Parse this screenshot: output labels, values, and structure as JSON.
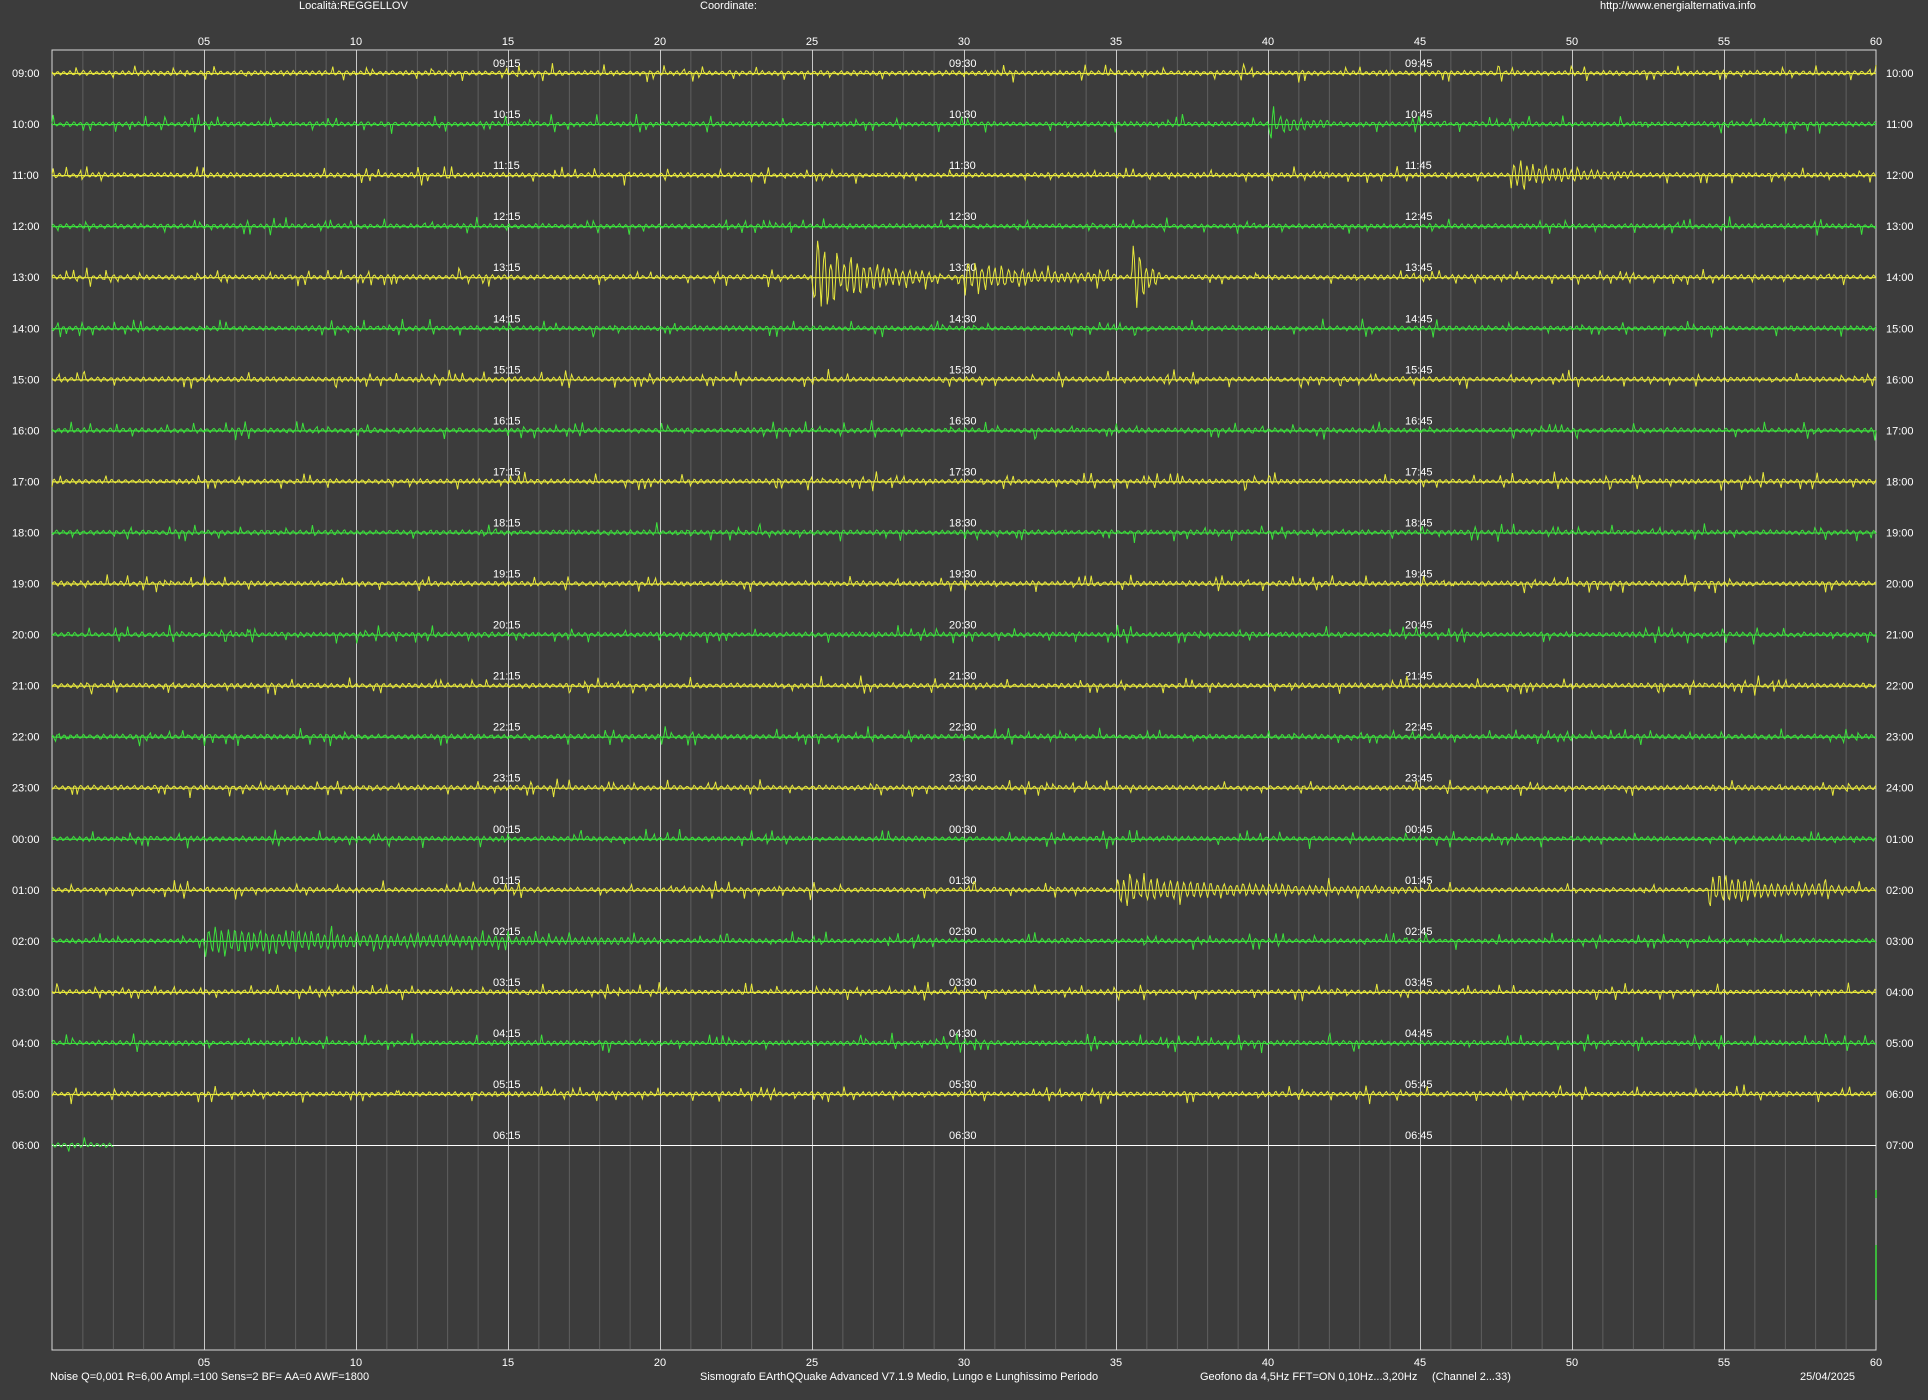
{
  "header": {
    "locality": "Località:REGGELLOV",
    "coordinates": "Coordinate:",
    "url": "http://www.energialternativa.info"
  },
  "footer": {
    "params": "Noise Q=0,001 R=6,00 Ampl.=100 Sens=2 BF= AA=0 AWF=1800",
    "software": "Sismografo  EArthQQuake Advanced V7.1.9  Medio, Lungo e Lunghissimo Periodo",
    "sensor": "Geofono da 4,5Hz FFT=ON 0,10Hz...3,20Hz",
    "channel": "(Channel 2...33)",
    "date": "25/04/2025"
  },
  "colors": {
    "background": "#3c3c3c",
    "trace_yellow": "#e8e83c",
    "trace_green": "#3ce03c",
    "grid_major": "#d8d8d8",
    "grid_minor": "#7a7a7a"
  },
  "chart_data": {
    "type": "line",
    "title": "",
    "xlabel": "",
    "ylabel": "",
    "x_unit": "minutes",
    "xlim": [
      0,
      60
    ],
    "x_ticks": [
      "05",
      "10",
      "15",
      "20",
      "25",
      "30",
      "35",
      "40",
      "45",
      "50",
      "55",
      "60"
    ],
    "left_labels": [
      "09:00",
      "10:00",
      "11:00",
      "12:00",
      "13:00",
      "14:00",
      "15:00",
      "16:00",
      "17:00",
      "18:00",
      "19:00",
      "20:00",
      "21:00",
      "22:00",
      "23:00",
      "00:00",
      "01:00",
      "02:00",
      "03:00",
      "04:00",
      "05:00",
      "06:00"
    ],
    "right_labels": [
      "10:00",
      "11:00",
      "12:00",
      "13:00",
      "14:00",
      "15:00",
      "16:00",
      "17:00",
      "18:00",
      "19:00",
      "20:00",
      "21:00",
      "22:00",
      "23:00",
      "24:00",
      "01:00",
      "02:00",
      "03:00",
      "04:00",
      "05:00",
      "06:00",
      "07:00"
    ],
    "quarter_labels": [
      [
        "09:15",
        "09:30",
        "09:45"
      ],
      [
        "10:15",
        "10:30",
        "10:45"
      ],
      [
        "11:15",
        "11:30",
        "11:45"
      ],
      [
        "12:15",
        "12:30",
        "12:45"
      ],
      [
        "13:15",
        "13:30",
        "13:45"
      ],
      [
        "14:15",
        "14:30",
        "14:45"
      ],
      [
        "15:15",
        "15:30",
        "15:45"
      ],
      [
        "16:15",
        "16:30",
        "16:45"
      ],
      [
        "17:15",
        "17:30",
        "17:45"
      ],
      [
        "18:15",
        "18:30",
        "18:45"
      ],
      [
        "19:15",
        "19:30",
        "19:45"
      ],
      [
        "20:15",
        "20:30",
        "20:45"
      ],
      [
        "21:15",
        "21:30",
        "21:45"
      ],
      [
        "22:15",
        "22:30",
        "22:45"
      ],
      [
        "23:15",
        "23:30",
        "23:45"
      ],
      [
        "00:15",
        "00:30",
        "00:45"
      ],
      [
        "01:15",
        "01:30",
        "01:45"
      ],
      [
        "02:15",
        "02:30",
        "02:45"
      ],
      [
        "03:15",
        "03:30",
        "03:45"
      ],
      [
        "04:15",
        "04:30",
        "04:45"
      ],
      [
        "05:15",
        "05:30",
        "05:45"
      ],
      [
        "06:15",
        "06:30",
        "06:45"
      ]
    ],
    "series_colors": [
      "yellow",
      "green"
    ],
    "recorded_minutes_last_row": 2,
    "events": [
      {
        "row": 4,
        "start_min": 25.0,
        "end_min": 29.0,
        "amplitude": 1.0
      },
      {
        "row": 4,
        "start_min": 35.5,
        "end_min": 36.5,
        "amplitude": 1.1
      },
      {
        "row": 4,
        "start_min": 30.0,
        "end_min": 35.0,
        "amplitude": 0.45
      },
      {
        "row": 16,
        "start_min": 54.5,
        "end_min": 59.5,
        "amplitude": 0.45
      },
      {
        "row": 16,
        "start_min": 35.0,
        "end_min": 45.0,
        "amplitude": 0.3
      },
      {
        "row": 17,
        "start_min": 5.0,
        "end_min": 20.0,
        "amplitude": 0.35
      },
      {
        "row": 1,
        "start_min": 40.0,
        "end_min": 42.0,
        "amplitude": 0.35
      },
      {
        "row": 2,
        "start_min": 48.0,
        "end_min": 52.0,
        "amplitude": 0.35
      },
      {
        "row": 22,
        "start_min": 0,
        "end_min": 0,
        "amplitude": 0
      }
    ]
  }
}
